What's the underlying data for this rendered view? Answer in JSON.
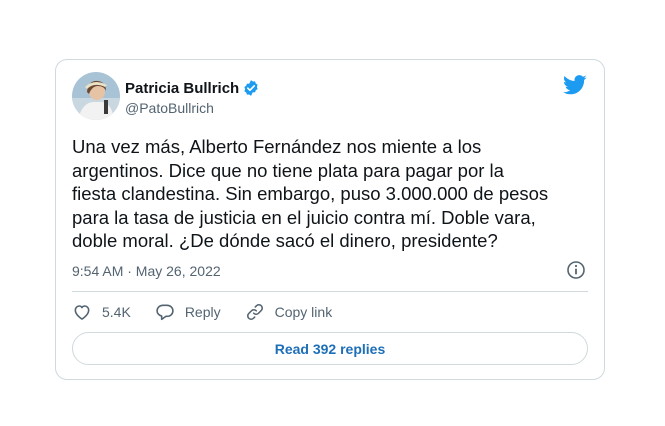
{
  "tweet": {
    "author_name": "Patricia Bullrich",
    "author_handle": "@PatoBullrich",
    "text": "Una vez más, Alberto Fernández nos miente a los\nargentinos. Dice que no tiene plata para pagar por la\nfiesta clandestina. Sin embargo, puso 3.000.000 de pesos\npara la tasa de justicia en el juicio contra mí. Doble vara,\ndoble moral. ¿De dónde sacó el dinero, presidente?",
    "timestamp": "9:54 AM · May 26, 2022",
    "likes": "5.4K",
    "reply_label": "Reply",
    "copy_link_label": "Copy link",
    "read_replies_label": "Read 392 replies"
  },
  "icons": {
    "verified": "verified-badge-icon",
    "brand": "twitter-bird-icon",
    "info": "info-icon",
    "like": "heart-icon",
    "reply": "reply-bubble-icon",
    "copy_link": "link-icon"
  },
  "colors": {
    "brand": "#1d9bf0",
    "link_text": "#1d6fb8",
    "secondary_text": "#536471",
    "border": "#cfd9de"
  }
}
